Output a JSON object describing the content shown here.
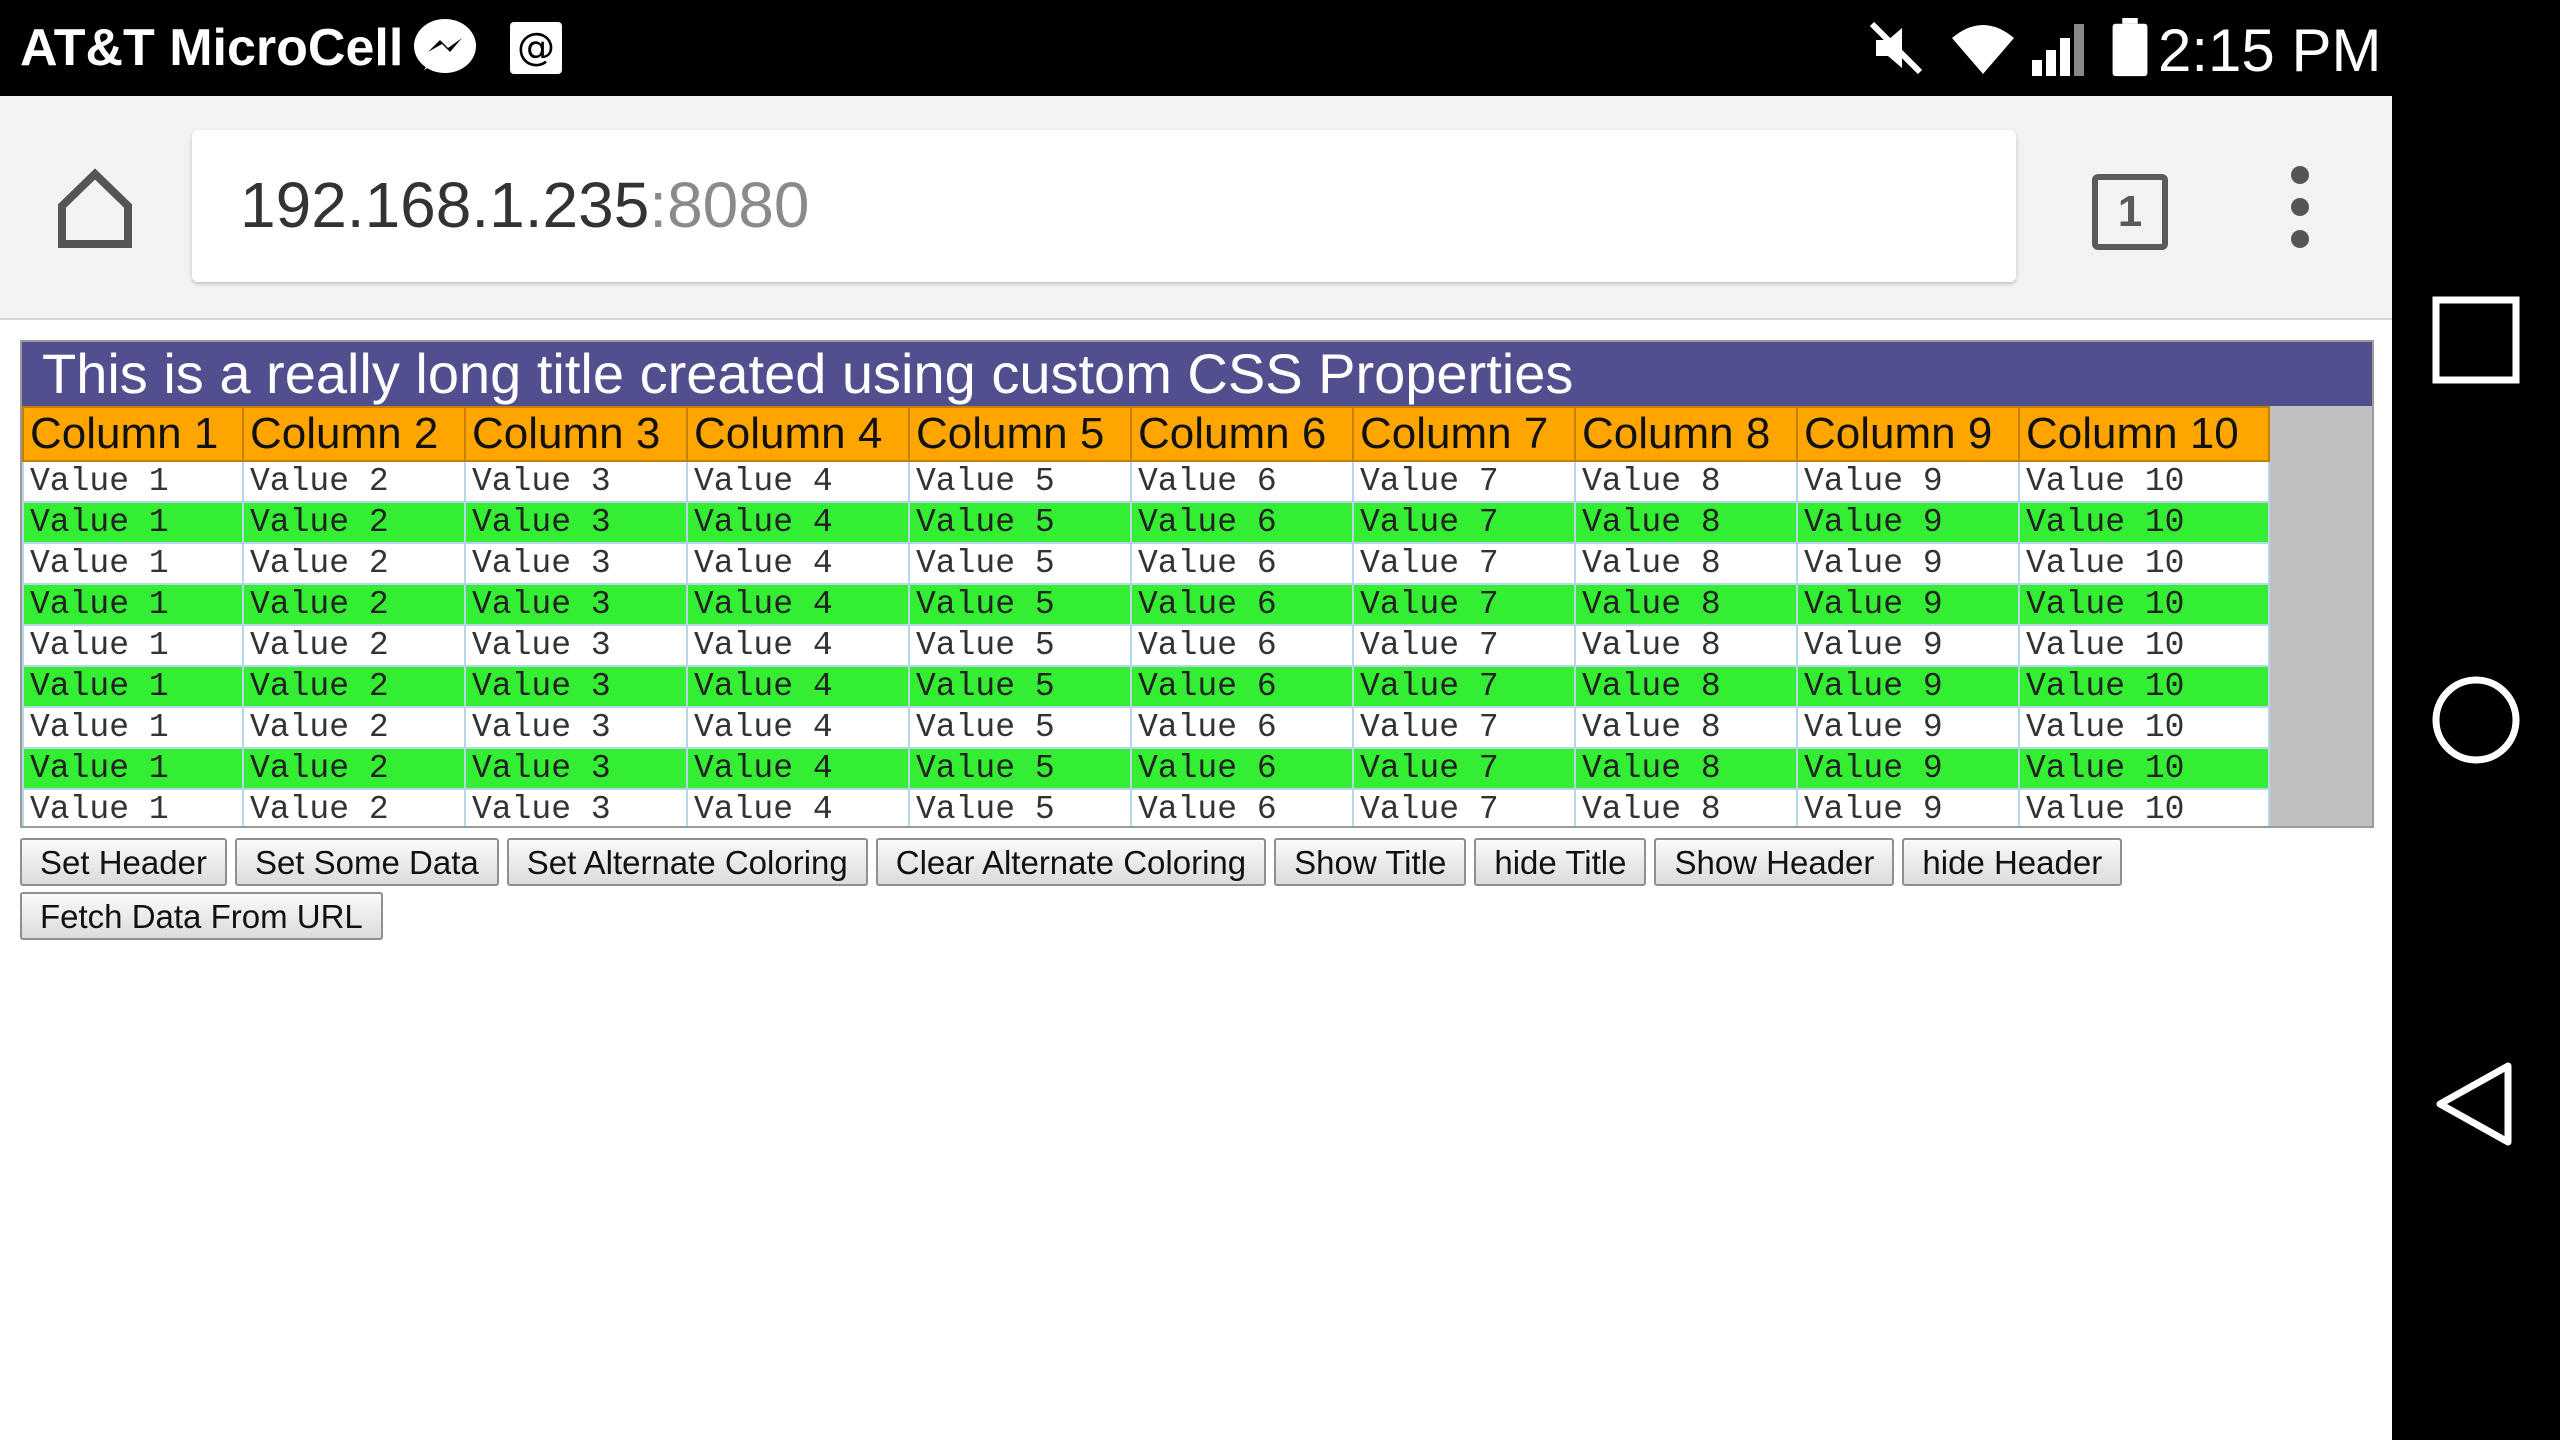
{
  "status_bar": {
    "carrier": "AT&T MicroCell",
    "time": "2:15 PM",
    "icons": [
      "messenger-icon",
      "email-icon",
      "mute-icon",
      "wifi-icon",
      "signal-icon",
      "battery-icon"
    ]
  },
  "browser": {
    "url_host": "192.168.1.235",
    "url_port": ":8080",
    "tab_count": "1"
  },
  "grid": {
    "title": "This is a really long title created using custom CSS Properties",
    "columns": [
      "Column 1",
      "Column 2",
      "Column 3",
      "Column 4",
      "Column 5",
      "Column 6",
      "Column 7",
      "Column 8",
      "Column 9",
      "Column 10"
    ],
    "row_values": [
      "Value 1",
      "Value 2",
      "Value 3",
      "Value 4",
      "Value 5",
      "Value 6",
      "Value 7",
      "Value 8",
      "Value 9",
      "Value 10"
    ],
    "colors": {
      "title_bg": "#524f8e",
      "header_bg": "#ffa500",
      "alt_row_bg": "#33ee33"
    }
  },
  "buttons": {
    "set_header": "Set Header",
    "set_some_data": "Set Some Data",
    "set_alternate_coloring": "Set Alternate Coloring",
    "clear_alternate_coloring": "Clear Alternate Coloring",
    "show_title": "Show Title",
    "hide_title": "hide Title",
    "show_header": "Show Header",
    "hide_header": "hide Header",
    "fetch_data": "Fetch Data From URL"
  }
}
